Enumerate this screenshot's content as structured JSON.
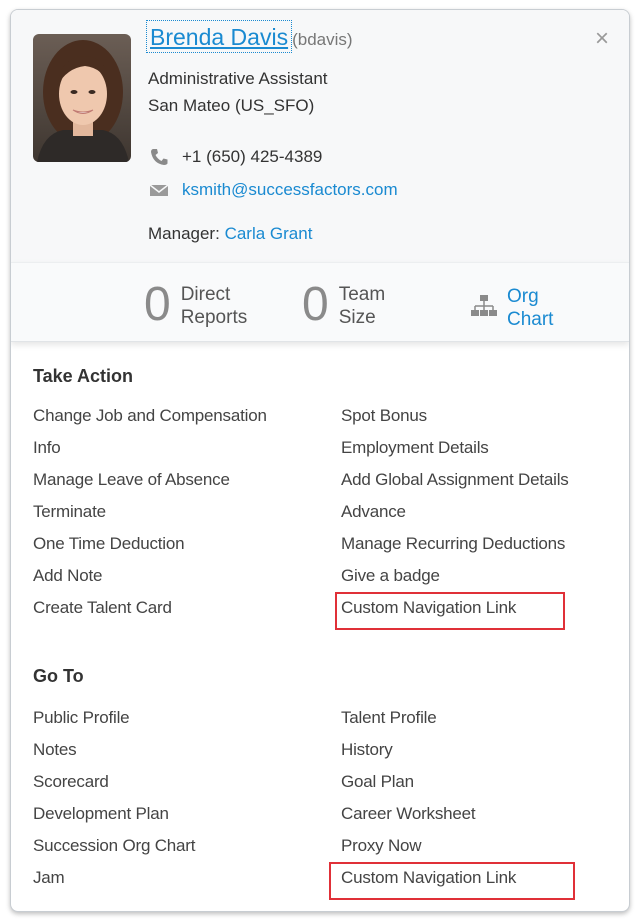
{
  "profile": {
    "name": "Brenda Davis",
    "username": "(bdavis)",
    "job_title": "Administrative Assistant",
    "location": "San Mateo (US_SFO)",
    "phone": "+1 (650) 425-4389",
    "email": "ksmith@successfactors.com",
    "manager_label": "Manager:",
    "manager_name": "Carla Grant"
  },
  "stats": {
    "direct_reports_count": "0",
    "direct_reports_label_1": "Direct",
    "direct_reports_label_2": "Reports",
    "team_size_count": "0",
    "team_size_label_1": "Team",
    "team_size_label_2": "Size",
    "org_chart_label_1": "Org",
    "org_chart_label_2": "Chart"
  },
  "take_action": {
    "title": "Take Action",
    "left": [
      "Change Job and Compensation",
      "Info",
      "Manage Leave of Absence",
      "Terminate",
      "One Time Deduction",
      "Add Note",
      "Create Talent Card"
    ],
    "right": [
      "Spot Bonus",
      "Employment Details",
      "Add Global Assignment Details",
      "Advance",
      "Manage Recurring Deductions",
      "Give a badge",
      "Custom Navigation Link"
    ]
  },
  "go_to": {
    "title": "Go To",
    "left": [
      "Public Profile",
      "Notes",
      "Scorecard",
      "Development Plan",
      "Succession Org Chart",
      "Jam"
    ],
    "right": [
      "Talent Profile",
      "History",
      "Goal Plan",
      "Career Worksheet",
      "Proxy Now",
      "Custom Navigation Link"
    ]
  },
  "icons": {
    "close": "close-icon",
    "phone": "phone-icon",
    "email": "email-icon",
    "org_chart": "org-chart-icon"
  },
  "colors": {
    "link": "#1a8ad1",
    "highlight": "#e03038"
  }
}
